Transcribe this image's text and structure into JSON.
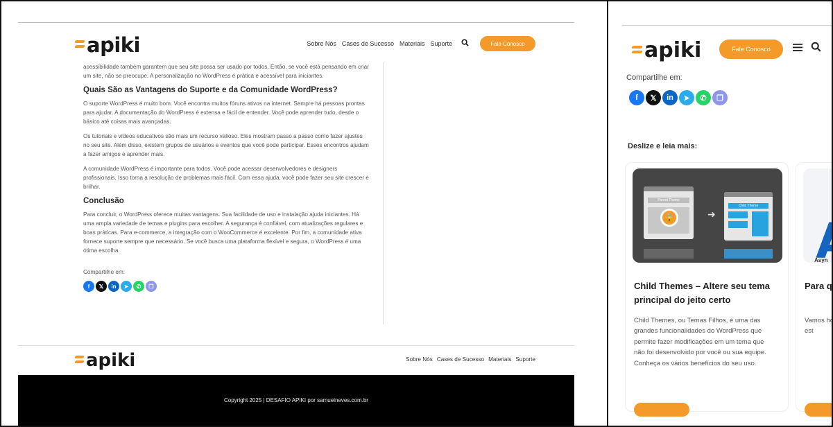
{
  "brand": {
    "logo_text": "apiki",
    "accent": "#f39a2b"
  },
  "desktop": {
    "nav": [
      "Sobre Nós",
      "Cases de Sucesso",
      "Materiais",
      "Suporte"
    ],
    "cta_label": "Fale Conosco",
    "article": {
      "p0": "acessibilidade também garantem que seu site possa ser usado por todos. Então, se você está pensando em criar um site, não se preocupe. A personalização no WordPress é prática e acessível para iniciantes.",
      "h_support": "Quais São as Vantagens do Suporte e da Comunidade WordPress?",
      "p1": "O suporte WordPress é muito bom. Você encontra muitos fóruns ativos na internet. Sempre há pessoas prontas para ajudar. A documentação do WordPress é extensa e fácil de entender. Você pode aprender tudo, desde o básico até coisas mais avançadas.",
      "p2": "Os tutoriais e vídeos educativos são mais um recurso valioso. Eles mostram passo a passo como fazer ajustes no seu site. Além disso, existem grupos de usuários e eventos que você pode participar. Esses encontros ajudam a fazer amigos e aprender mais.",
      "p3": "A comunidade WordPress é importante para todos. Você pode acessar desenvolvedores e designers profissionais. Isso torna a resolução de problemas mais fácil. Com essa ajuda, você pode fazer seu site crescer e brilhar.",
      "h_conclusion": "Conclusão",
      "p4": "Para concluir, o WordPress oferece muitas vantagens. Sua facilidade de uso e instalação ajuda iniciantes. Há uma ampla variedade de temas e plugins para escolher. A segurança é confiável, com atualizações regulares e boas práticas. Para e-commerce, a integração com o WooCommerce é excelente. Por fim, a comunidade ativa fornece suporte sempre que necessário. Se você busca uma plataforma flexível e segura, o WordPress é uma ótima escolha.",
      "share_label": "Compartilhe em:"
    },
    "footer_nav": [
      "Sobre Nós",
      "Cases de Sucesso",
      "Materiais",
      "Suporte"
    ],
    "copyright": "Copyright 2025 | DESAFIO APIKI por samuelneves.com.br"
  },
  "share_icons": [
    {
      "name": "facebook-icon",
      "glyph": "f",
      "color": "#1877f2"
    },
    {
      "name": "x-icon",
      "glyph": "𝕏",
      "color": "#111111"
    },
    {
      "name": "linkedin-icon",
      "glyph": "in",
      "color": "#0a66c2"
    },
    {
      "name": "telegram-icon",
      "glyph": "➤",
      "color": "#2aabee"
    },
    {
      "name": "whatsapp-icon",
      "glyph": "✆",
      "color": "#25d366"
    },
    {
      "name": "copy-link-icon",
      "glyph": "❐",
      "color": "#8f95ec"
    }
  ],
  "mobile": {
    "cta_label": "Fale Conosco",
    "share_label": "Compartilhe em:",
    "more_label": "Deslize e leia mais:",
    "cards": [
      {
        "title": "Child Themes – Altere seu tema principal do jeito certo",
        "desc": "Child Themes, ou Temas Filhos, é uma das grandes funcionalidades do WordPress que permite fazer modificações em um tema que não foi desenvolvido por você ou sua equipe. Conheça os vários benefícios do seu uso.",
        "img_left_label": "Parent Theme",
        "img_right_label": "Child Theme"
      },
      {
        "title": "Para q usá-lo",
        "desc": "Vamos homena da DC C para tor interativ Leia est",
        "img_letter": "A",
        "img_sub": "Asyn"
      }
    ]
  }
}
